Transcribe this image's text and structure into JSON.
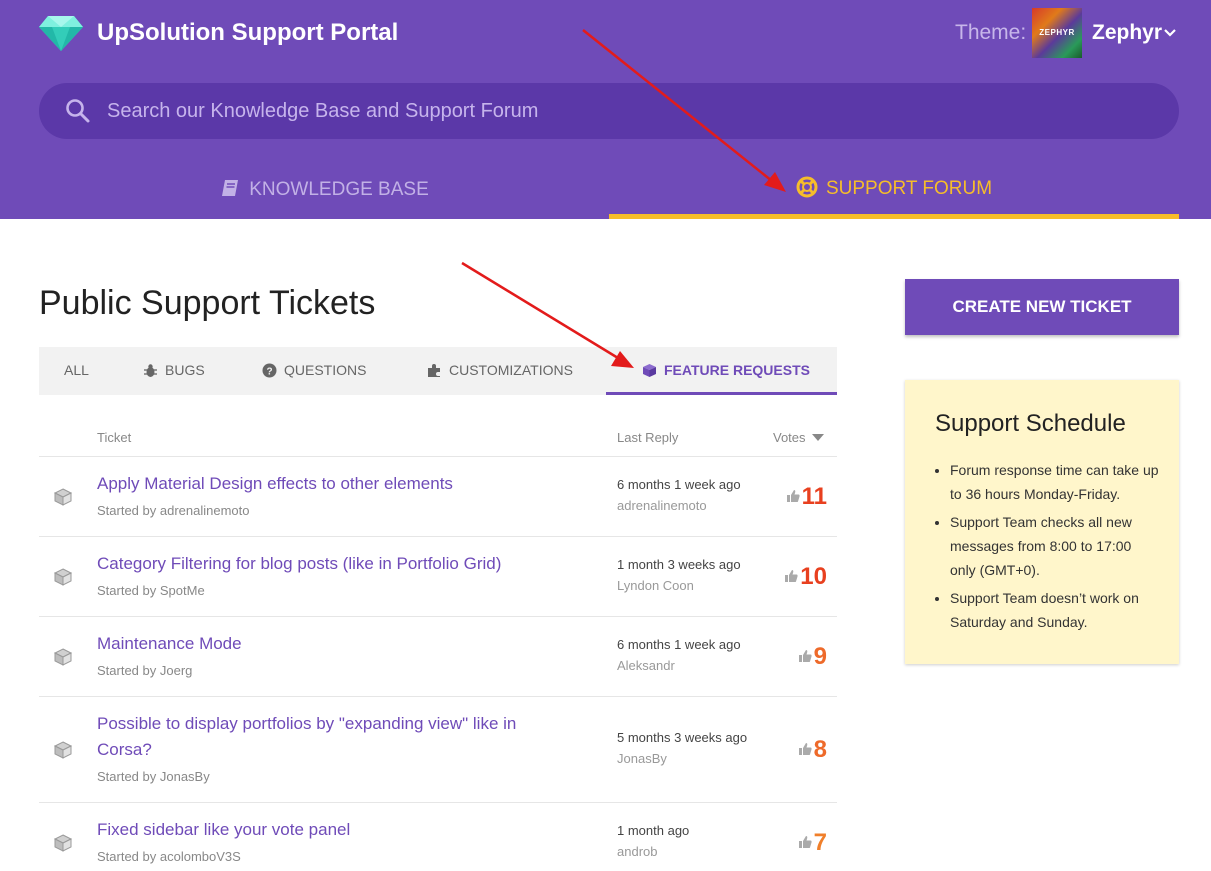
{
  "header": {
    "site_title": "UpSolution Support Portal",
    "theme_label": "Theme:",
    "theme_thumb_text": "ZEPHYR",
    "theme_name": "Zephyr",
    "search_placeholder": "Search our Knowledge Base and Support Forum",
    "tabs": [
      {
        "label": "KNOWLEDGE BASE",
        "icon": "book-icon",
        "active": false
      },
      {
        "label": "SUPPORT FORUM",
        "icon": "lifebuoy-icon",
        "active": true
      }
    ],
    "colors": {
      "header_bg": "#6f4bb8",
      "accent": "#f6bd2a"
    }
  },
  "main": {
    "page_title": "Public Support Tickets",
    "filter_tabs": [
      {
        "label": "ALL",
        "icon": null
      },
      {
        "label": "BUGS",
        "icon": "bug-icon"
      },
      {
        "label": "QUESTIONS",
        "icon": "question-circle-icon"
      },
      {
        "label": "CUSTOMIZATIONS",
        "icon": "puzzle-icon"
      },
      {
        "label": "FEATURE REQUESTS",
        "icon": "cube-icon",
        "active": true
      }
    ],
    "columns": {
      "ticket": "Ticket",
      "last_reply": "Last Reply",
      "votes": "Votes"
    },
    "tickets": [
      {
        "title": "Apply Material Design effects to other elements",
        "starter": "Started by adrenalinemoto",
        "reply_time": "6 months 1 week ago",
        "reply_author": "adrenalinemoto",
        "votes": "11",
        "vote_color": "#e8401f"
      },
      {
        "title": "Category Filtering for blog posts (like in Portfolio Grid)",
        "starter": "Started by SpotMe",
        "reply_time": "1 month 3 weeks ago",
        "reply_author": "Lyndon Coon",
        "votes": "10",
        "vote_color": "#e8401f"
      },
      {
        "title": "Maintenance Mode",
        "starter": "Started by Joerg",
        "reply_time": "6 months 1 week ago",
        "reply_author": "Aleksandr",
        "votes": "9",
        "vote_color": "#ee6a2a"
      },
      {
        "title": "Possible to display portfolios by \"expanding view\" like in Corsa?",
        "starter": "Started by JonasBy",
        "reply_time": "5 months 3 weeks ago",
        "reply_author": "JonasBy",
        "votes": "8",
        "vote_color": "#ee6a2a"
      },
      {
        "title": "Fixed sidebar like your vote panel",
        "starter": "Started by acolomboV3S",
        "reply_time": "1 month ago",
        "reply_author": "androb",
        "votes": "7",
        "vote_color": "#f07f2a"
      }
    ]
  },
  "sidebar": {
    "create_button": "CREATE NEW TICKET",
    "schedule_title": "Support Schedule",
    "schedule_items": [
      "Forum response time can take up to 36 hours Monday-Friday.",
      "Support Team checks all new messages from 8:00 to 17:00 only (GMT+0).",
      "Support Team doesn’t work on Saturday and Sunday."
    ]
  }
}
